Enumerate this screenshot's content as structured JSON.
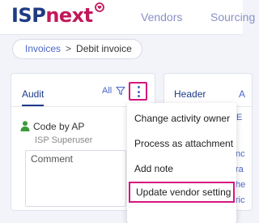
{
  "brand": {
    "logo_main": "ISP",
    "logo_accent": "next"
  },
  "nav": {
    "vendors": "Vendors",
    "sourcing": "Sourcing"
  },
  "breadcrumb": {
    "link": "Invoices",
    "separator": ">",
    "current": "Debit invoice"
  },
  "audit_panel": {
    "tab": "Audit",
    "filter_label": "All",
    "entry": {
      "title": "Code by AP",
      "user": "ISP Superuser",
      "comment_placeholder": "Comment"
    }
  },
  "header_panel": {
    "tab": "Header",
    "tab_next_partial": "A",
    "side_fragments": [
      "E",
      "nc",
      "ra",
      "he",
      "ric"
    ]
  },
  "menu": {
    "items": [
      "Change activity owner",
      "Process as attachment",
      "Add note",
      "Update vendor setting"
    ]
  },
  "colors": {
    "brand_navy": "#1f3b84",
    "brand_accent": "#c2185b",
    "highlight": "#d6167d",
    "link": "#4a66c8",
    "user_icon": "#3a9a3a"
  }
}
